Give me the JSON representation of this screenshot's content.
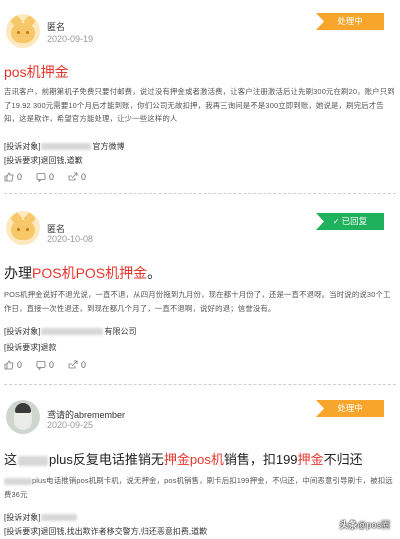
{
  "posts": [
    {
      "user": "匿名",
      "date": "2020-09-19",
      "status": "处理中",
      "title": "pos机押金",
      "body": "吉讯客户，前期第机子免费只要付邮费，说过没有押金或者激活费，让客户注册激活后让先刷300元在刷20，账户只到了19.92 300元需要10个月后才能到账，你们公司无故扣押，我再三询问是不是300立即到账，她说是，刷完后才告知，这是欺诈，希望官方能处理，让少一些这样的人",
      "target_label": "[投诉对象]",
      "target_value_suffix": "官方微博",
      "request_label": "[投诉要求]",
      "request_value": "退回钱,道歉",
      "likes": "0",
      "comments": "0",
      "shares": "0"
    },
    {
      "user": "匿名",
      "date": "2020-10-08",
      "status": "已回复",
      "title_parts": [
        "办理",
        "POS机POS机押金",
        "。"
      ],
      "body": "POS机押金说好不退光说，一直不退，从四月份拖到九月份，现在都十月份了，还是一直不退呀。当时说的说30个工作日，直接一次性退还，到现在都几个月了，一直不退啊，说好的退；信誉没有。",
      "target_label": "[投诉对象]",
      "target_value_suffix": "有限公司",
      "request_label": "[投诉要求]",
      "request_value": "退款",
      "likes": "0",
      "comments": "0",
      "shares": "0"
    },
    {
      "user": "鸢请的abremember",
      "date": "2020-09-25",
      "status": "处理中",
      "title_parts": [
        "这",
        "plus反复电话推销无",
        "押金pos机",
        "销售，扣199",
        "押金",
        "不归还"
      ],
      "body": "plus电话推销pos机刷卡机，说无押金，pos机销售，刷卡后扣199押金，不归还，中间恶意引导刷卡，被扣远费36元",
      "target_label": "[投诉对象]",
      "request_label": "[投诉要求]",
      "request_value": "退回钱,找出欺诈者移交警方,归还恶意扣费,道歉"
    }
  ],
  "watermark": {
    "prefix": "头条",
    "handle": "@pos圈"
  },
  "colors": {
    "processing": "#f8a62b",
    "replied": "#1fb15b",
    "highlight": "#e5352b"
  }
}
